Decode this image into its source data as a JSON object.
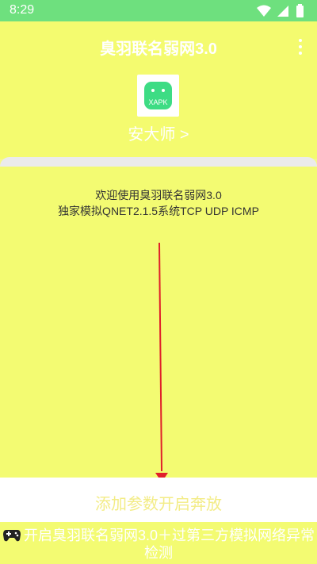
{
  "status_bar": {
    "time": "8:29",
    "icons": [
      "wifi-icon",
      "signal-icon",
      "battery-icon"
    ]
  },
  "app_bar": {
    "title": "臭羽联名弱网3.0",
    "menu_icon": "more-vert-icon"
  },
  "header": {
    "app_icon_label": "XAPK",
    "author_link": "安大师 >"
  },
  "card": {
    "line1": "欢迎使用臭羽联名弱网3.0",
    "line2": "独家模拟QNET2.1.5系统TCP UDP ICMP"
  },
  "buttons": {
    "add_params": "添加参数开启奔放",
    "start": "开启臭羽联名弱网3.0＋过第三方模拟网络异常检测"
  },
  "colors": {
    "accent_yellow": "#f4fb6f",
    "status_green": "#6ee07e",
    "arrow_red": "#e0202a",
    "icon_green": "#3ddc84"
  }
}
